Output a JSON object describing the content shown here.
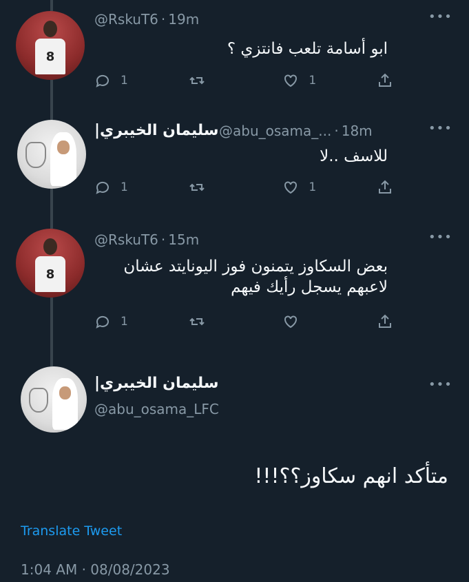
{
  "tweets": [
    {
      "name": "",
      "handle": "@RskuT6",
      "time": "19m",
      "text": "ابو أسامة تلعب فانتزي ؟",
      "replies": "1",
      "retweets": "",
      "likes": "1",
      "avatar": "player-jersey-8"
    },
    {
      "name": "سليمان الخيبري|",
      "handle": "@abu_osama_...",
      "time": "18m",
      "text": "للاسف ..لا",
      "replies": "1",
      "retweets": "",
      "likes": "1",
      "avatar": "man-in-ghutra"
    },
    {
      "name": "",
      "handle": "@RskuT6",
      "time": "15m",
      "text": "بعض السكاوز يتمنون فوز اليونايتد عشان لاعبهم يسجل رأيك فيهم",
      "replies": "1",
      "retweets": "",
      "likes": "",
      "avatar": "player-jersey-8"
    }
  ],
  "main_tweet": {
    "name": "سليمان الخيبري|",
    "handle": "@abu_osama_LFC",
    "text": "متأكد انهم سكاوز؟؟!!!",
    "avatar": "man-in-ghutra"
  },
  "jersey_number": "8",
  "separator": "·",
  "more_icon": "•••",
  "translate_label": "Translate Tweet",
  "timestamp": "1:04 AM · 08/08/2023",
  "colors": {
    "background": "#15202b",
    "secondary_text": "#8899a6",
    "link": "#1d9bf0",
    "thread_line": "#38444d"
  }
}
